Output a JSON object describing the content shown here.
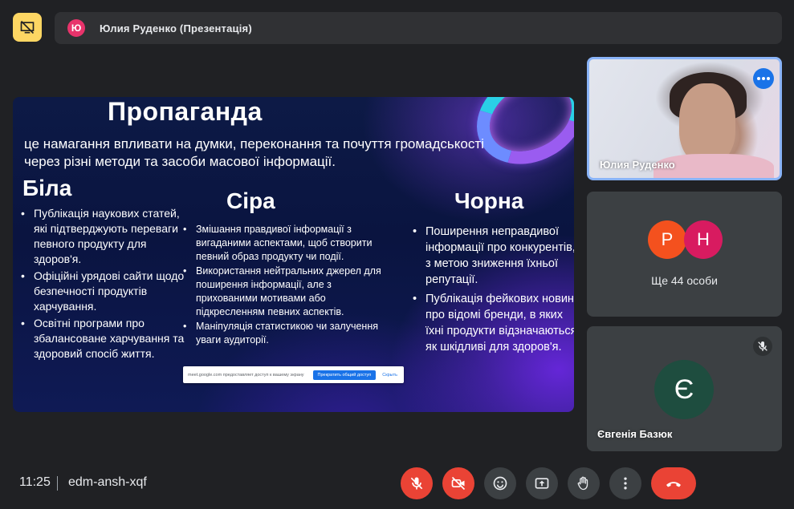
{
  "header": {
    "presenter_initial": "Ю",
    "presenter_label": "Юлия Руденко (Презентація)"
  },
  "slide": {
    "title": "Пропаганда",
    "subtitle": "це намагання впливати на думки, переконання та почуття громадськості через різні методи та засоби масової інформації.",
    "white": {
      "heading": "Біла",
      "items": [
        "Публікація наукових статей, які підтверджують переваги певного продукту для здоров'я.",
        "Офіційні урядові сайти щодо безпечності продуктів харчування.",
        "Освітні програми про збалансоване харчування та здоровий спосіб життя."
      ]
    },
    "gray": {
      "heading": "Сіра",
      "items": [
        "Змішання правдивої інформації з вигаданими аспектами, щоб створити певний образ продукту чи події.",
        "Використання нейтральних джерел для поширення інформації, але з прихованими мотивами або підкресленням певних аспектів.",
        "Маніпуляція статистикою чи залучення уваги аудиторії."
      ]
    },
    "black": {
      "heading": "Чорна",
      "items": [
        "Поширення неправдивої інформації про конкурентів, з метою зниження їхньої репутації.",
        "Публікація фейкових новин  про відомі бренди, в яких їхні продукти відзначаються як шкідливі для здоров'я."
      ]
    },
    "share_notice": {
      "text": "meet.google.com предоставляет доступ к вашему экрану",
      "stop_label": "Прекратить общий доступ",
      "hide_label": "Скрыть"
    }
  },
  "participants": {
    "self_view_name": "Юлия Руденко",
    "others_initials": [
      "Р",
      "Н"
    ],
    "others_colors": [
      "#f4511e",
      "#d81b60"
    ],
    "others_label": "Ще 44 особи",
    "yevheniia": {
      "initial": "Є",
      "name": "Євгенія Базюк"
    }
  },
  "footer": {
    "time": "11:25",
    "separator": "|",
    "meeting_code": "edm-ansh-xqf"
  },
  "controls": [
    {
      "name": "mic-off-button",
      "icon": "mic-off-icon",
      "state": "off"
    },
    {
      "name": "camera-off-button",
      "icon": "videocam-off-icon",
      "state": "off"
    },
    {
      "name": "emoji-button",
      "icon": "emoji-icon"
    },
    {
      "name": "present-button",
      "icon": "present-screen-icon"
    },
    {
      "name": "raise-hand-button",
      "icon": "hand-icon"
    },
    {
      "name": "more-options-button",
      "icon": "more-vert-icon"
    },
    {
      "name": "leave-call-button",
      "icon": "call-end-icon"
    }
  ],
  "colors": {
    "accent": "#1a73e8",
    "danger": "#ea4335",
    "pin": "#fdd663",
    "highlight_border": "#8ab4f8"
  }
}
